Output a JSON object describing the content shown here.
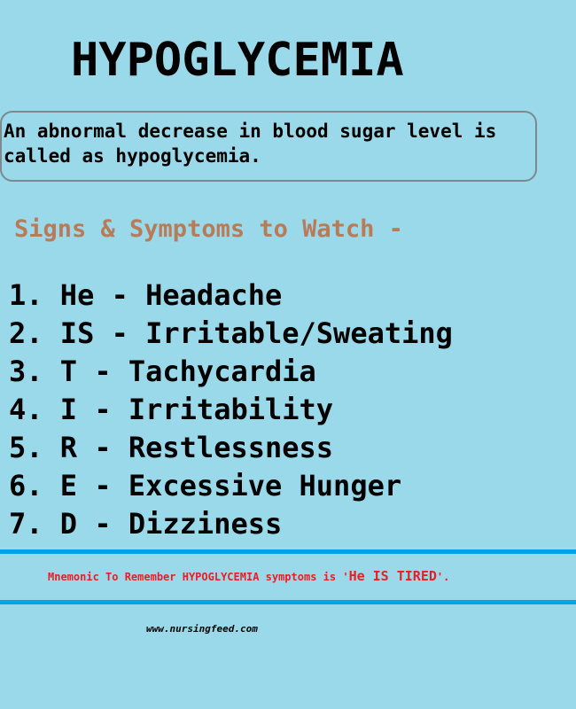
{
  "title": "HYPOGLYCEMIA",
  "definition": "An abnormal decrease in blood sugar level is called as hypoglycemia.",
  "subheading": "Signs & Symptoms to Watch -",
  "symptoms": [
    "1. He - Headache",
    "2. IS - Irritable/Sweating",
    "3. T - Tachycardia",
    "4. I - Irritability",
    "5. R - Restlessness",
    "6. E - Excessive Hunger",
    "7. D - Dizziness"
  ],
  "mnemonic": {
    "prefix": "Mnemonic To Remember HYPOGLYCEMIA symptoms is '",
    "phrase": "He IS TIRED",
    "suffix": "'."
  },
  "source": "www.nursingfeed.com",
  "colors": {
    "background": "#99d9ea",
    "subheading": "#b97a57",
    "divider": "#00a2e8",
    "mnemonic": "#ed1c24"
  }
}
